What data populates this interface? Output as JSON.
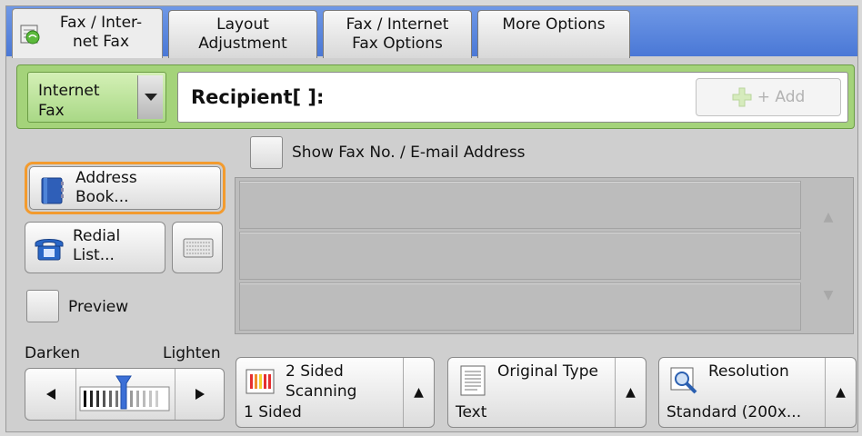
{
  "tabs": [
    {
      "label_line1": "Fax / Inter-",
      "label_line2": "net Fax",
      "active": true
    },
    {
      "label_line1": "Layout",
      "label_line2": "Adjustment",
      "active": false
    },
    {
      "label_line1": "Fax / Internet",
      "label_line2": "Fax Options",
      "active": false
    },
    {
      "label_line1": "More Options",
      "label_line2": "",
      "active": false
    }
  ],
  "recipient": {
    "type_line1": "Internet",
    "type_line2": "Fax",
    "label": "Recipient[   ]:",
    "add_label": "+ Add"
  },
  "show_address_label": "Show Fax No. / E-mail Address",
  "address_book": {
    "line1": "Address",
    "line2": "Book..."
  },
  "redial": {
    "line1": "Redial",
    "line2": "List..."
  },
  "preview_label": "Preview",
  "darkness": {
    "darken": "Darken",
    "lighten": "Lighten"
  },
  "two_sided": {
    "line1": "2 Sided",
    "line2": "Scanning",
    "value": "1 Sided"
  },
  "original_type": {
    "title": "Original Type",
    "value": "Text"
  },
  "resolution": {
    "title": "Resolution",
    "value": "Standard (200x..."
  },
  "colors": {
    "tab_bar": "#4a78d6",
    "recipient_bg": "#a4d37a",
    "highlight": "#f39b2e"
  }
}
